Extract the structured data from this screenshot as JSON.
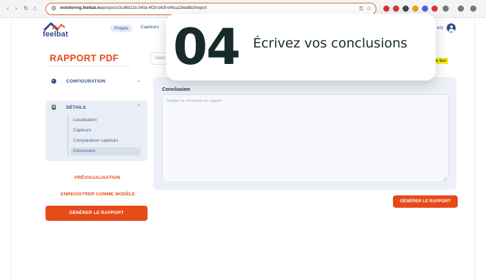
{
  "browser": {
    "url_prefix": "monitoring.feelbat.eu",
    "url_rest": "/projects/3cd6b11b-340a-4f2b-b63f-b4bca29ad6b3/report",
    "nav_icons": [
      "back-arrow",
      "forward-arrow",
      "reload",
      "home"
    ],
    "extension_colors": [
      "#d93434",
      "#d93434",
      "#444444",
      "#e8a010",
      "#5a5fd8",
      "#d93434",
      "#777777",
      "#777777",
      "#777777"
    ]
  },
  "app": {
    "logo_text": "feelbat",
    "nav": {
      "projects": "Projets",
      "sensors": "Capteurs"
    },
    "user": "ery",
    "page_title": "RAPPORT PDF",
    "select_placeholder": "Sélec",
    "highlight_text": "e lien",
    "sidebar": {
      "configuration": "CONFIGURATION",
      "details": "DÉTAILS",
      "sub_items": [
        "Localisation",
        "Capteurs",
        "Comparaison capteurs",
        "Conclusion"
      ],
      "active_sub_item": "Conclusion",
      "preview": "PRÉVISUALISATION",
      "save_template": "ENREGISTRER COMME MODÈLE",
      "generate": "GÉNÉRER LE RAPPORT"
    },
    "main": {
      "conclusion_label": "Conclusion",
      "conclusion_placeholder": "Rédiger la conclusion du rapport",
      "generate_button": "GÉNÉRER LE RAPPORT"
    }
  },
  "overlay": {
    "step_number": "04",
    "step_text": "Écrivez vos conclusions"
  },
  "colors": {
    "accent_orange": "#e64a19",
    "brand_blue": "#2a4b8d",
    "url_border": "#d9672e",
    "highlight": "#f7ee2a"
  }
}
